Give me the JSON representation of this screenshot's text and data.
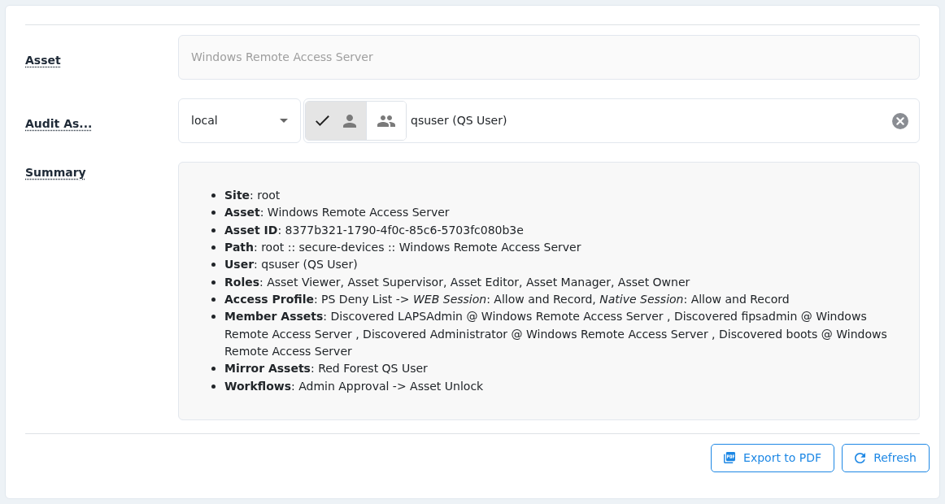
{
  "form": {
    "fields": [
      {
        "kind": "text",
        "label": "Asset",
        "value": "Windows Remote Access Server",
        "disabled": true
      },
      {
        "kind": "account",
        "label": "Audit As...",
        "scope": "local",
        "modes": [
          {
            "kind": "user",
            "selected": true
          },
          {
            "kind": "group",
            "selected": false
          }
        ],
        "value": "qsuser (QS User)"
      },
      {
        "kind": "summary",
        "label": "Summary",
        "items": [
          "**Site**: root",
          "**Asset**: Windows Remote Access Server",
          "**Asset ID**: 8377b321-1790-4f0c-85c6-5703fc080b3e",
          "**Path**: root :: secure-devices :: Windows Remote Access Server",
          "**User**: qsuser (QS User)",
          "**Roles**: Asset Viewer, Asset Supervisor, Asset Editor, Asset Manager, Asset Owner",
          "**Access Profile**: PS Deny List -> *WEB Session*: Allow and Record, *Native Session*: Allow and Record",
          "**Member Assets**: Discovered LAPSAdmin @ Windows Remote Access Server , Discovered fipsadmin @ Windows Remote Access Server , Discovered Administrator @ Windows Remote Access Server , Discovered boots @ Windows Remote Access Server",
          "**Mirror Assets**: Red Forest QS User",
          "**Workflows**: Admin Approval -> Asset Unlock"
        ]
      }
    ]
  },
  "buttons": [
    {
      "kind": "export",
      "label": "Export to PDF"
    },
    {
      "kind": "refresh",
      "label": "Refresh"
    }
  ]
}
